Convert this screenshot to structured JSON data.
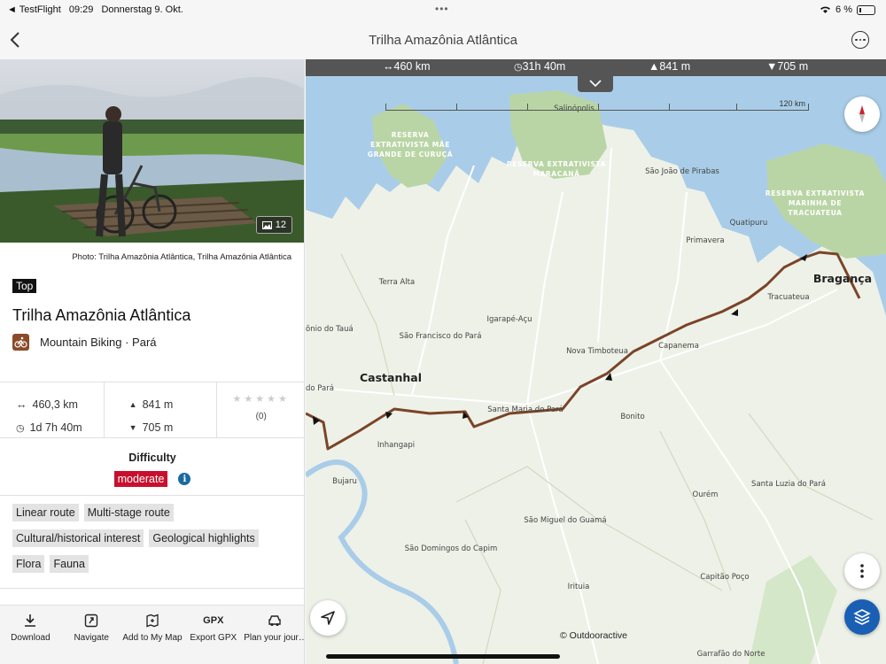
{
  "status": {
    "app": "◄ TestFlight",
    "time": "09:29",
    "date": "Donnerstag 9. Okt.",
    "battery": "6 %"
  },
  "nav": {
    "title": "Trilha Amazônia Atlântica"
  },
  "panel": {
    "photo_count": "12",
    "photo_credit": "Photo: Trilha Amazônia Atlântica, Trilha Amazônia Atlântica",
    "badge": "Top",
    "title": "Trilha Amazônia Atlântica",
    "activity": "Mountain Biking · Pará",
    "stats": {
      "distance": "460,3 km",
      "duration": "1d 7h 40m",
      "ascent": "841 m",
      "descent": "705 m",
      "stars": "★★★★★",
      "rating_count": "(0)"
    },
    "difficulty_label": "Difficulty",
    "difficulty_value": "moderate",
    "tags": [
      "Linear route",
      "Multi-stage route",
      "Cultural/historical interest",
      "Geological highlights",
      "Flora",
      "Fauna"
    ],
    "toolbar": [
      {
        "label": "Download",
        "icon": "download-icon"
      },
      {
        "label": "Navigate",
        "icon": "navigate-icon"
      },
      {
        "label": "Add to My Map",
        "icon": "map-add-icon"
      },
      {
        "label": "Export GPX",
        "icon": "GPX"
      },
      {
        "label": "Plan your jour…",
        "icon": "car-icon"
      }
    ]
  },
  "map": {
    "top": {
      "distance": "↔460 km",
      "duration": "31h 40m",
      "ascent": "▲841 m",
      "descent": "▼705 m"
    },
    "scale_label": "120 km",
    "copyright": "© Outdooractive",
    "reserves": [
      [
        "RESERVA",
        "EXTRATIVISTA MÃE",
        "GRANDE DE CURUÇÁ"
      ],
      [
        "RESERVA EXTRATIVISTA",
        "MARACANÃ"
      ],
      [
        "RESERVA EXTRATIVISTA",
        "MARINHA DE",
        "TRACUATEUA"
      ]
    ],
    "places": {
      "salinopolis": "Salinópolis",
      "sao_joao": "São João de Pirabas",
      "quatipuru": "Quatipuru",
      "primavera": "Primavera",
      "braganca": "Bragança",
      "tracuateua": "Tracuateua",
      "terra_alta": "Terra Alta",
      "igarape": "Igarapé-Açu",
      "taua": "ônio do Tauá",
      "sao_francisco": "São Francisco do Pará",
      "nova_timboteua": "Nova Timboteua",
      "capanema": "Capanema",
      "castanhal": "Castanhal",
      "do_para": "do Pará",
      "santa_maria": "Santa Maria do Pará",
      "bonito": "Bonito",
      "inhangapi": "Inhangapi",
      "bujaru": "Bujaru",
      "ourem": "Ourém",
      "santa_luzia": "Santa Luzia do Pará",
      "sao_miguel": "São Miguel do Guamá",
      "sao_domingos": "São Domingos do Capim",
      "capitao_poco": "Capitão Poço",
      "irituia": "Irituia",
      "garrafao": "Garrafão do Norte"
    }
  }
}
